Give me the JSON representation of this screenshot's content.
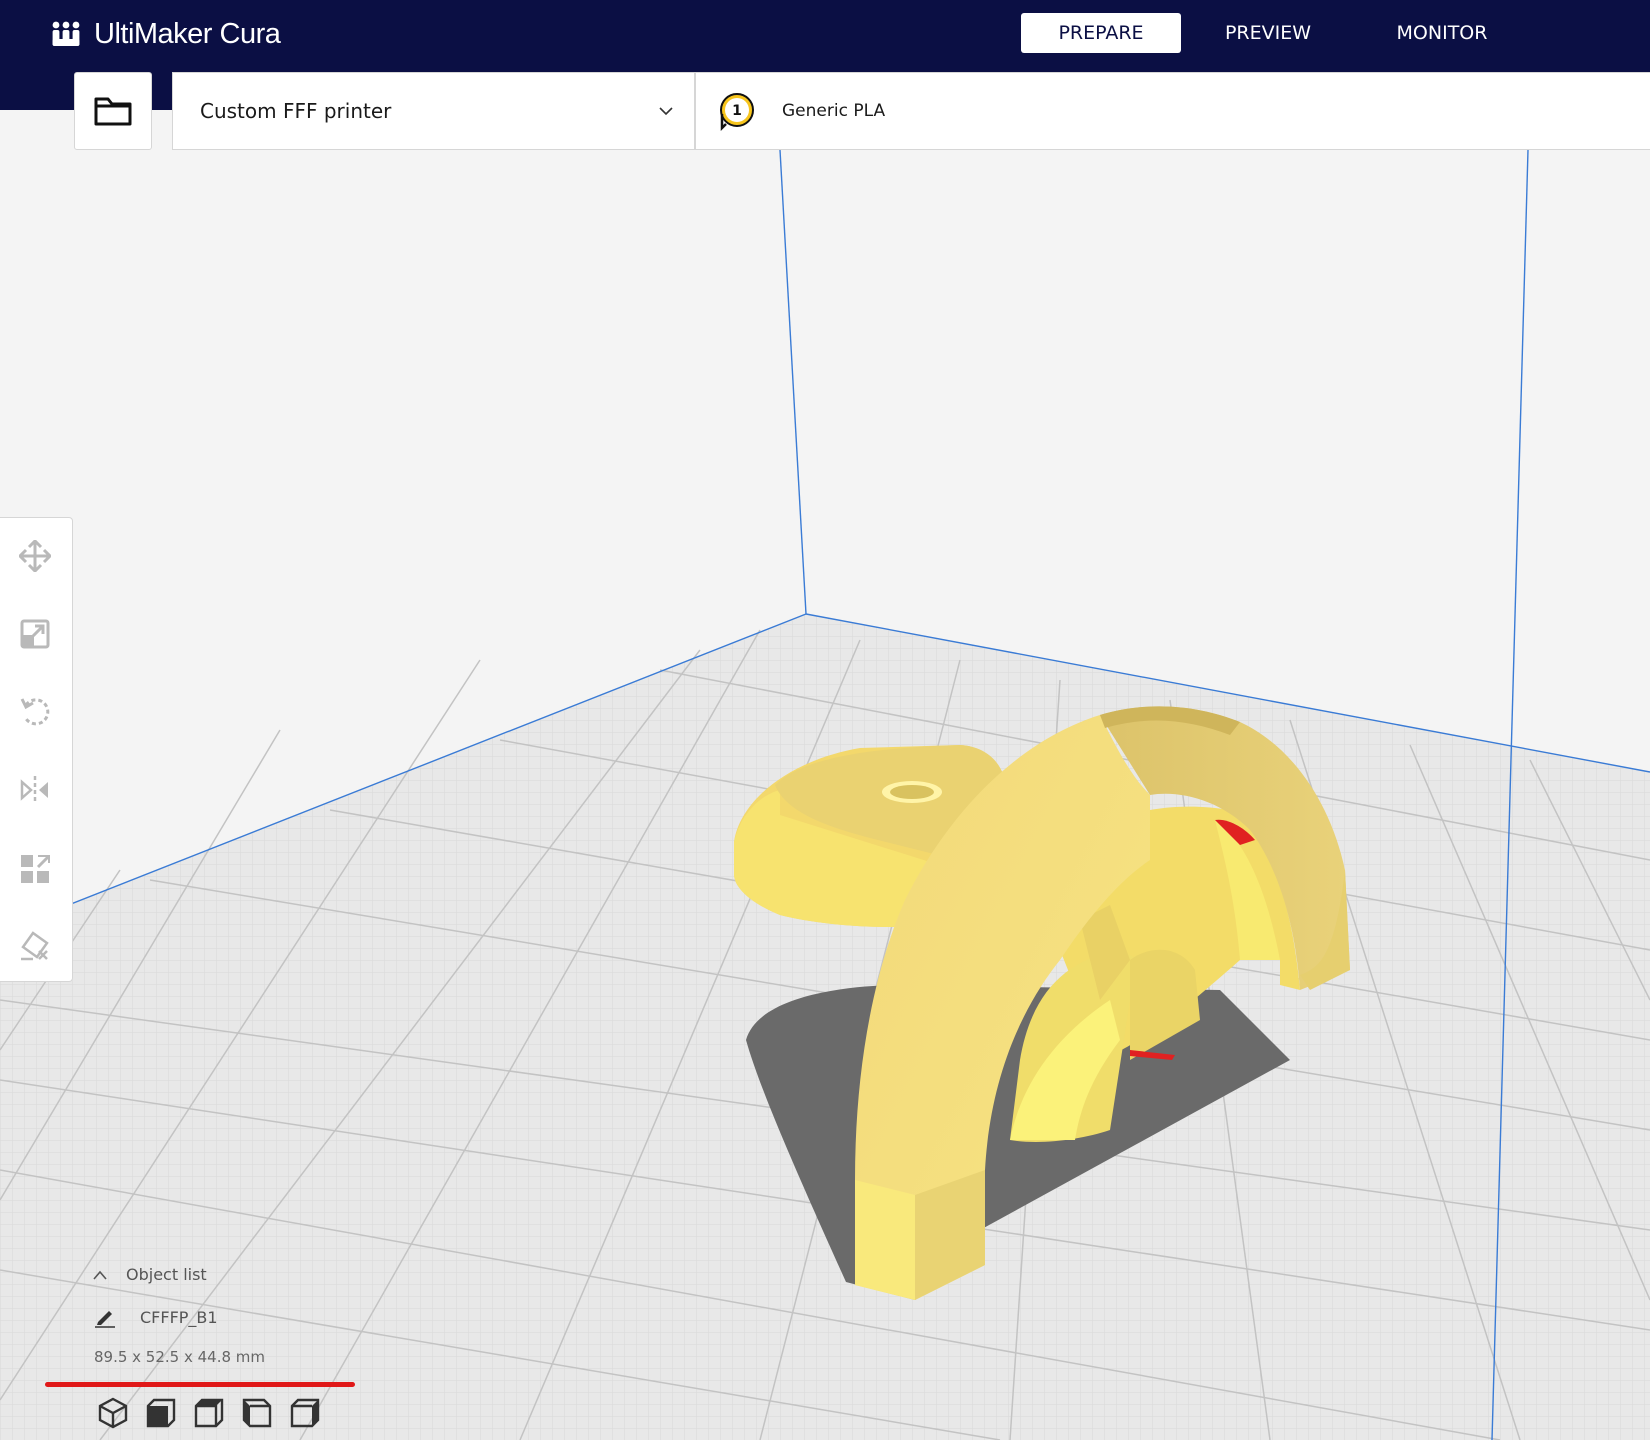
{
  "app": {
    "logo_text": "UltiMaker Cura"
  },
  "stages": [
    {
      "label": "PREPARE",
      "active": true
    },
    {
      "label": "PREVIEW",
      "active": false
    },
    {
      "label": "MONITOR",
      "active": false
    }
  ],
  "toolbar": {
    "open_icon": "folder-icon",
    "printer_name": "Custom FFF printer",
    "extruder_number": "1",
    "material_name": "Generic PLA"
  },
  "tools": [
    {
      "name": "move-tool",
      "icon": "move-icon"
    },
    {
      "name": "scale-tool",
      "icon": "scale-icon"
    },
    {
      "name": "rotate-tool",
      "icon": "rotate-icon"
    },
    {
      "name": "mirror-tool",
      "icon": "mirror-icon"
    },
    {
      "name": "per-model-settings-tool",
      "icon": "per-model-settings-icon"
    },
    {
      "name": "support-blocker-tool",
      "icon": "support-blocker-icon"
    }
  ],
  "object_panel": {
    "toggle_label": "Object list",
    "object_name": "CFFFP_B1",
    "dimensions": "89.5 x 52.5 x 44.8 mm"
  },
  "view_buttons": [
    {
      "name": "3d-view",
      "icon": "cube-3d-icon"
    },
    {
      "name": "front-view",
      "icon": "cube-front-icon"
    },
    {
      "name": "top-view",
      "icon": "cube-top-icon"
    },
    {
      "name": "left-view",
      "icon": "cube-left-icon"
    },
    {
      "name": "right-view",
      "icon": "cube-right-icon"
    }
  ],
  "colors": {
    "header_bg": "#0b0f44",
    "model_yellow": "#f5e06a",
    "build_volume_line": "#3a7bd5",
    "highlight_red": "#e01818"
  }
}
